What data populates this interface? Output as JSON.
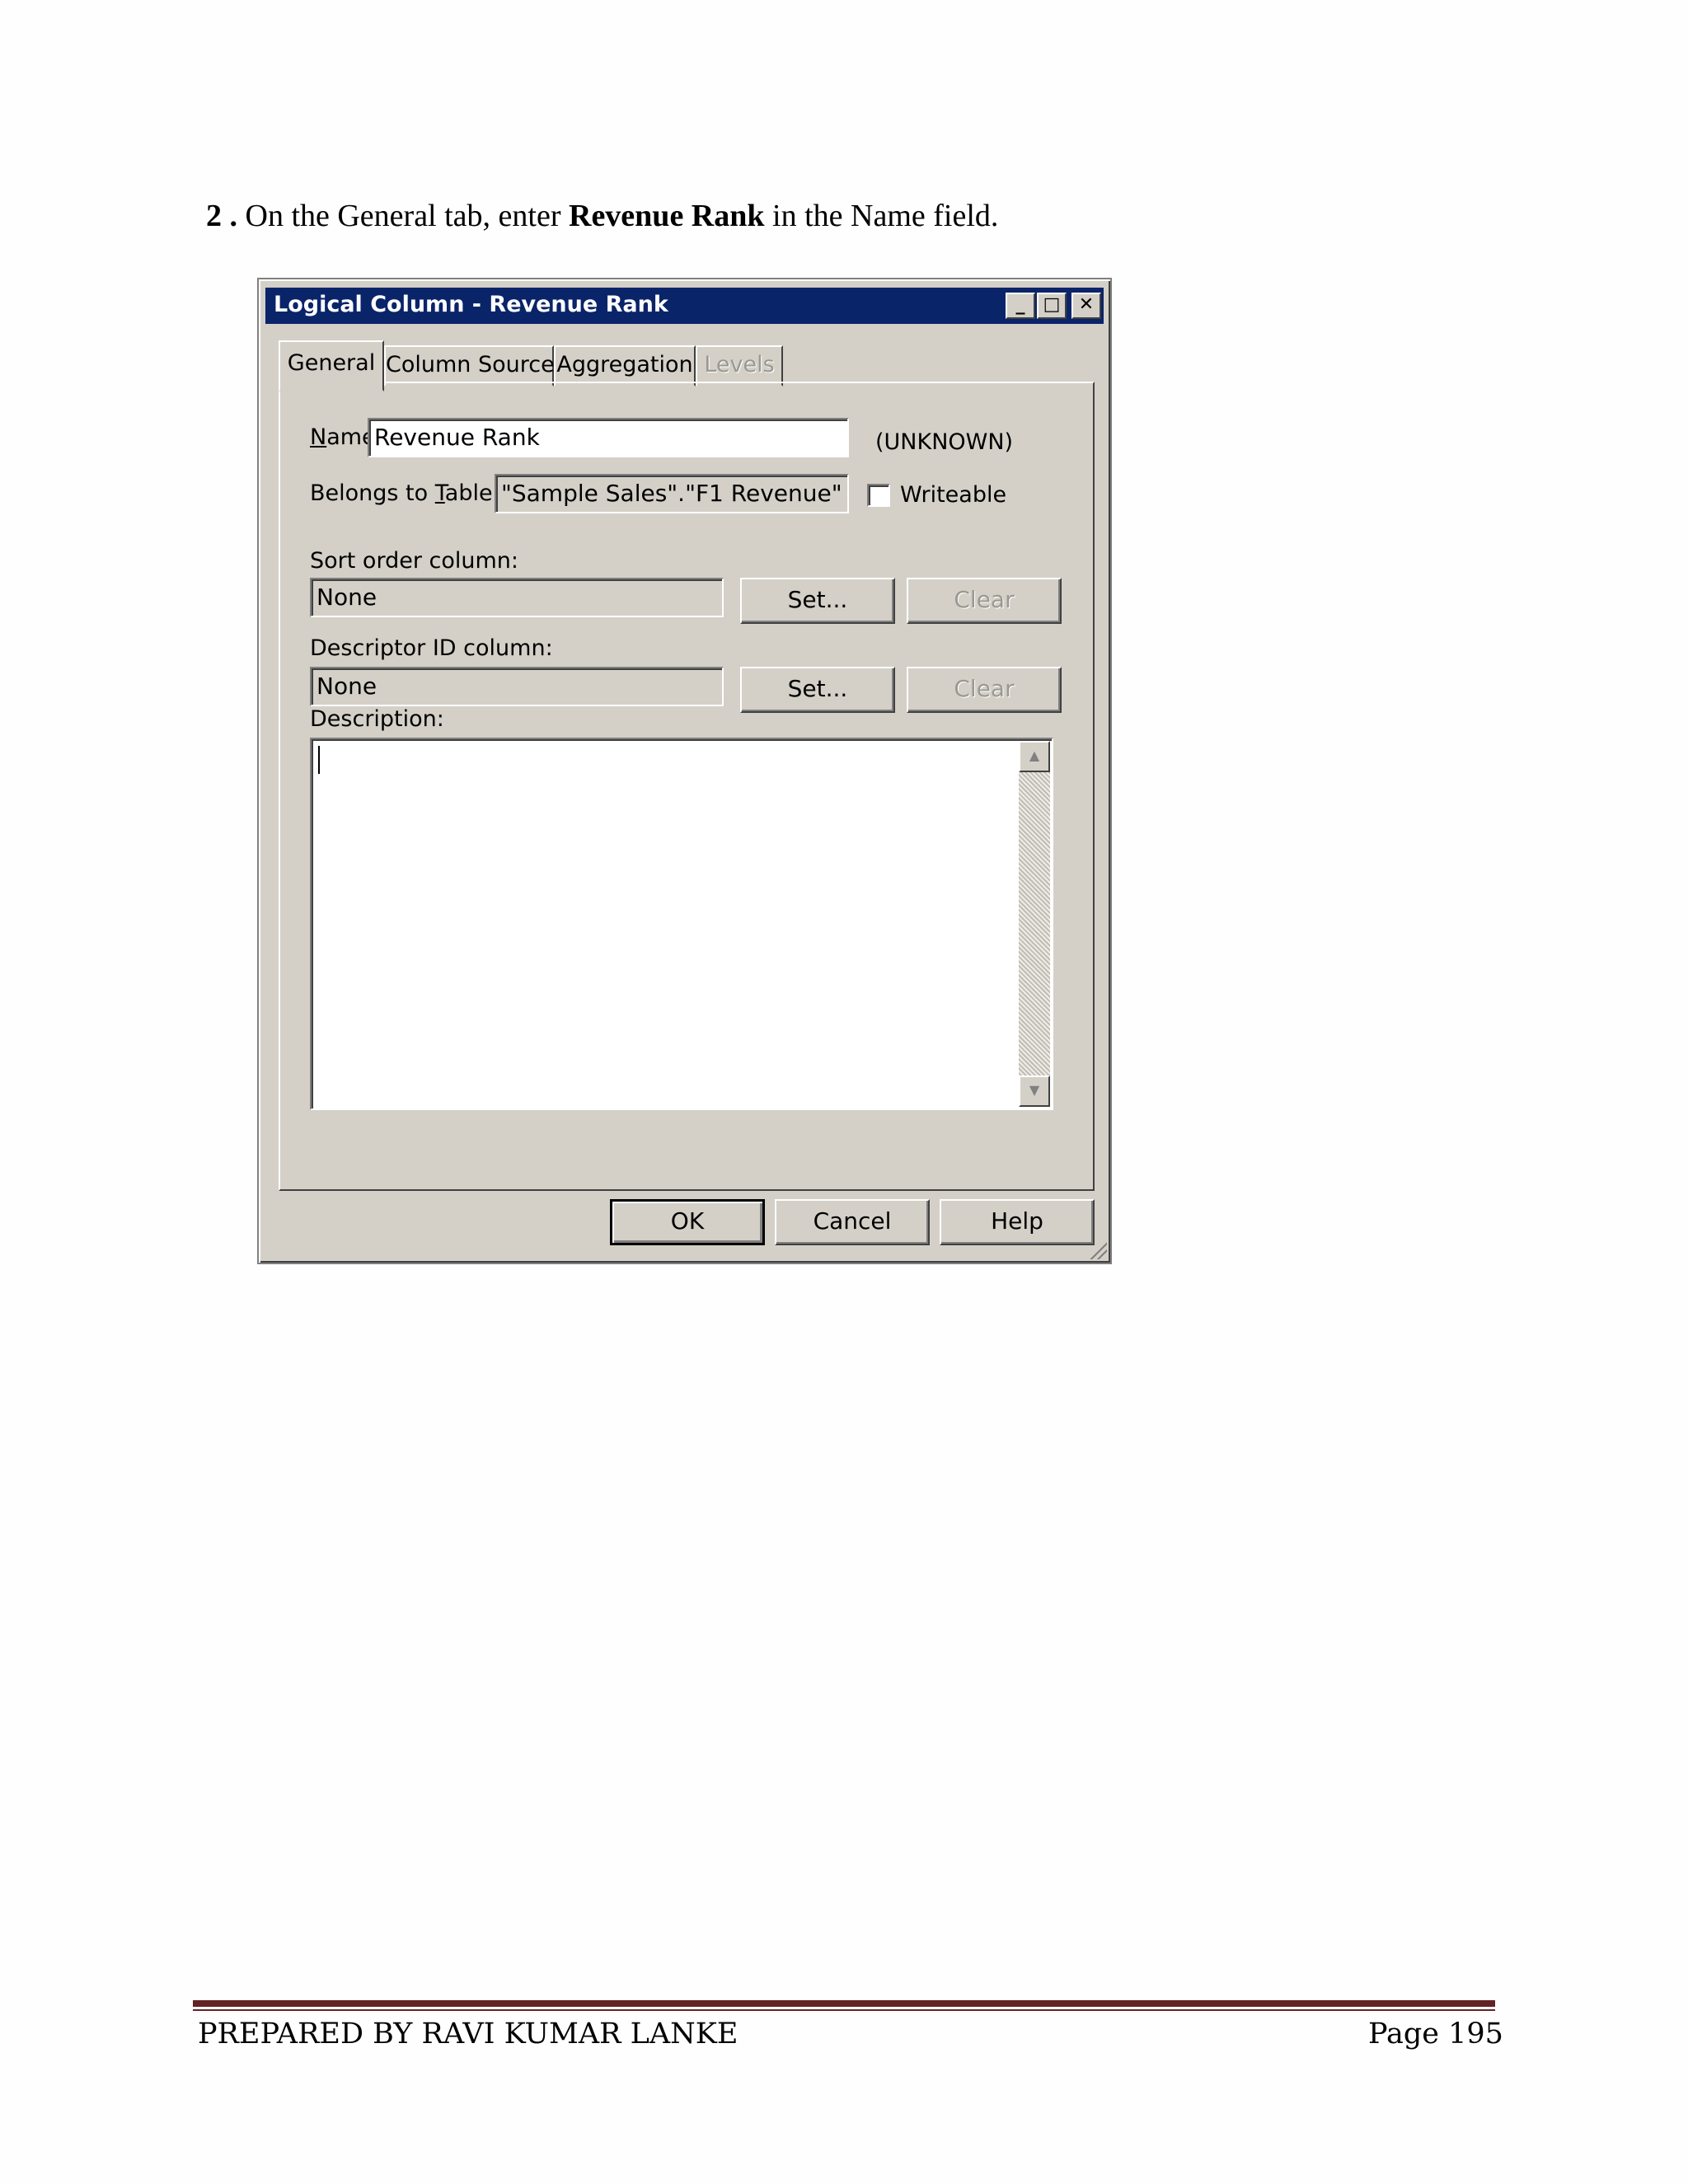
{
  "instruction": {
    "step": "2 .",
    "pre": "On the General tab, enter",
    "bold": "Revenue Rank",
    "post": "in the Name field."
  },
  "dialog": {
    "title": "Logical Column - Revenue Rank",
    "window_buttons": {
      "minimize": "_",
      "maximize": "□",
      "close": "✕"
    },
    "tabs": [
      {
        "label": "General",
        "state": "active"
      },
      {
        "label": "Column Source",
        "state": "normal"
      },
      {
        "label": "Aggregation",
        "state": "normal"
      },
      {
        "label": "Levels",
        "state": "disabled"
      }
    ],
    "name_label": "Name:",
    "name_value": "Revenue Rank",
    "type_value": "(UNKNOWN)",
    "table_label_pre": "Belongs to ",
    "table_label_u": "T",
    "table_label_post": "able:",
    "table_value": "\"Sample Sales\".\"F1 Revenue\"",
    "writeable_label": "Writeable",
    "writeable_checked": false,
    "sort_label": "Sort order column:",
    "sort_value": "None",
    "descriptor_label": "Descriptor ID column:",
    "descriptor_value": "None",
    "set_label": "Set...",
    "clear_label": "Clear",
    "description_label": "Description:",
    "description_value": "",
    "ok_label": "OK",
    "cancel_label": "Cancel",
    "help_label": "Help"
  },
  "footer": {
    "prepared_by": "PREPARED BY RAVI KUMAR LANKE",
    "page": "Page 195"
  },
  "colors": {
    "titlebar": "#0a246a",
    "dialog_bg": "#d4d0c8",
    "footer_rule": "#622423"
  }
}
